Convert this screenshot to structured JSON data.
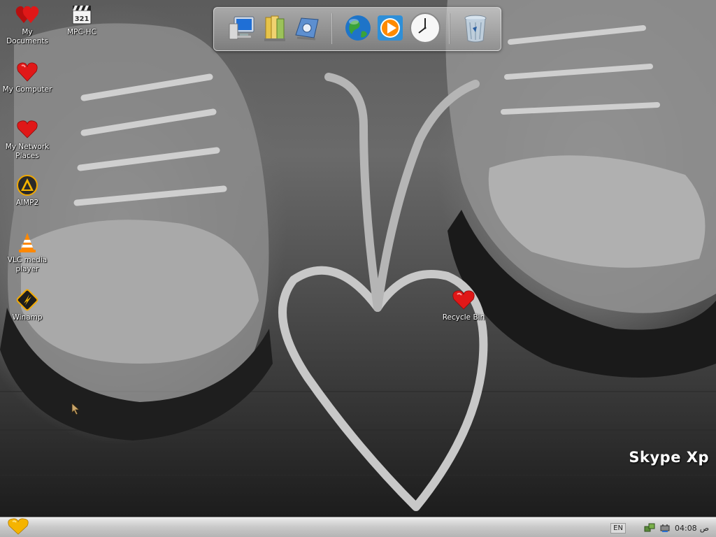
{
  "desktop": {
    "icons": [
      {
        "label": "My Documents",
        "icon": "heart-documents-icon"
      },
      {
        "label": "MPC-HC",
        "icon": "mpc-hc-clapper-icon"
      },
      {
        "label": "My Computer",
        "icon": "heart-computer-icon"
      },
      {
        "label": "My Network Places",
        "icon": "heart-network-icon"
      },
      {
        "label": "AIMP2",
        "icon": "aimp-icon"
      },
      {
        "label": "VLC media player",
        "icon": "vlc-cone-icon"
      },
      {
        "label": "Winamp",
        "icon": "winamp-icon"
      },
      {
        "label": "Recycle Bin",
        "icon": "heart-recycle-icon"
      }
    ]
  },
  "dock": {
    "items": [
      {
        "icon": "monitor-icon"
      },
      {
        "icon": "folder-icon"
      },
      {
        "icon": "control-panel-icon"
      },
      {
        "icon": "globe-icon"
      },
      {
        "icon": "media-player-icon"
      },
      {
        "icon": "clock-icon"
      },
      {
        "icon": "trash-icon"
      }
    ]
  },
  "brand": {
    "text": "Skype Xp"
  },
  "taskbar": {
    "start_icon": "heart-start-icon",
    "language": "EN",
    "clock_time": "04:08",
    "clock_suffix": "ص"
  },
  "colors": {
    "heart_red": "#e01818",
    "start_heart": "#f5b400",
    "taskbar": "#c9c9c9"
  }
}
